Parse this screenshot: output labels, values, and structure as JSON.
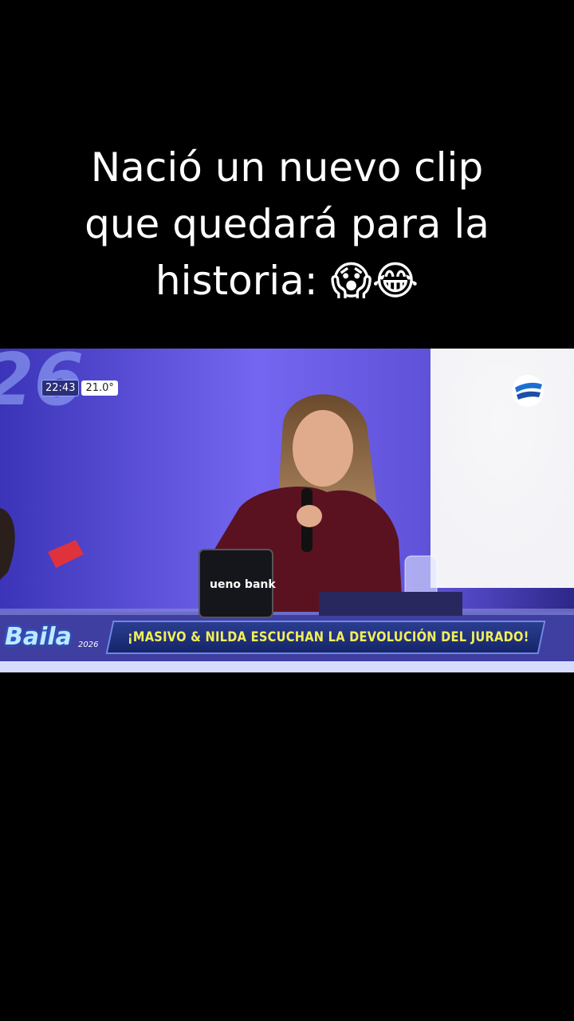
{
  "caption": {
    "line1": "Nació un nuevo clip",
    "line2": "que quedará para la",
    "line3": "historia: 😱😂"
  },
  "broadcast": {
    "clock_time": "22:43",
    "temperature": "21.0°",
    "lower_third": "¡MASIVO & NILDA ESCUCHAN LA DEVOLUCIÓN DEL JURADO!",
    "show_logo": "Baila",
    "show_year": "2026",
    "sponsor_text": "ueno bank",
    "background_text": "26"
  }
}
